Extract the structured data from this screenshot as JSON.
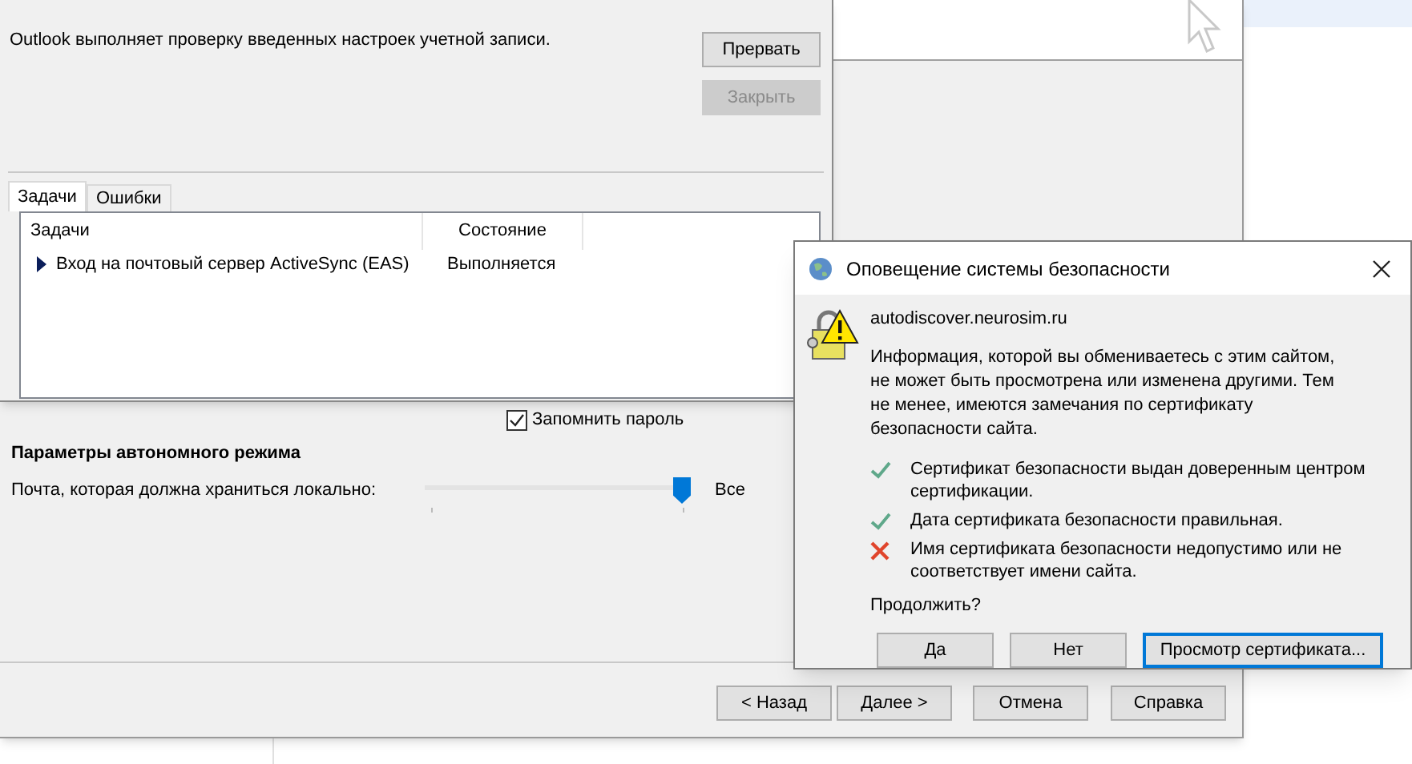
{
  "wizard": {
    "remember_password": {
      "label": "Запомнить пароль",
      "checked": true
    },
    "offline": {
      "heading": "Параметры автономного режима",
      "label": "Почта, которая должна храниться локально:",
      "level": 1,
      "reading": "Все"
    },
    "buttons": [
      {
        "label": "< Назад",
        "disabled": false
      },
      {
        "label": "Далее >",
        "disabled": false
      },
      {
        "label": "Отмена",
        "disabled": false
      },
      {
        "label": "Справка",
        "disabled": false
      }
    ]
  },
  "test_dialog": {
    "message": "Outlook выполняет проверку введенных настроек учетной записи.",
    "buttons": [
      {
        "label": "Прервать",
        "disabled": false
      },
      {
        "label": "Закрыть",
        "disabled": true
      }
    ],
    "tabs": [
      {
        "label": "Задачи",
        "selected": true
      },
      {
        "label": "Ошибки",
        "selected": false
      }
    ],
    "table": {
      "columns": [
        "Задачи",
        "Состояние"
      ],
      "rows": [
        {
          "cells": [
            "Вход на почтовый сервер ActiveSync (EAS)",
            "Выполняется"
          ],
          "current": true
        }
      ]
    }
  },
  "security_alert": {
    "title": "Оповещение системы безопасности",
    "host": "autodiscover.neurosim.ru",
    "message": "Информация, которой вы обмениваетесь с этим сайтом, не может быть просмотрена или изменена другими. Тем не менее, имеются замечания по сертификату безопасности сайта.",
    "checks": [
      {
        "text": "Сертификат безопасности выдан доверенным центром сертификации.",
        "passed": true
      },
      {
        "text": "Дата сертификата безопасности правильная.",
        "passed": true
      },
      {
        "text": "Имя сертификата безопасности недопустимо или не соответствует имени сайта.",
        "passed": false
      }
    ],
    "question": "Продолжить?",
    "buttons": [
      {
        "label": "Да",
        "default": false
      },
      {
        "label": "Нет",
        "default": false
      },
      {
        "label": "Просмотр сертификата...",
        "default": true
      }
    ]
  }
}
